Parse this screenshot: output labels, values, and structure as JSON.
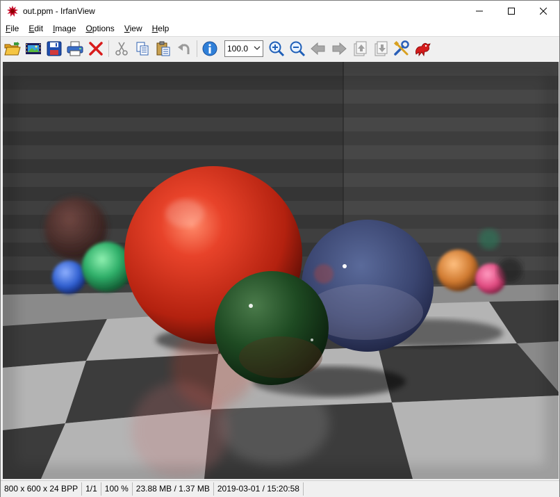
{
  "window": {
    "title": "out.ppm - IrfanView",
    "icon": "irfanview-red-splat-icon"
  },
  "menu": [
    {
      "label": "File",
      "accel": "F",
      "rest": "ile"
    },
    {
      "label": "Edit",
      "accel": "E",
      "rest": "dit"
    },
    {
      "label": "Image",
      "accel": "I",
      "rest": "mage"
    },
    {
      "label": "Options",
      "accel": "O",
      "rest": "ptions"
    },
    {
      "label": "View",
      "accel": "V",
      "rest": "iew"
    },
    {
      "label": "Help",
      "accel": "H",
      "rest": "elp"
    }
  ],
  "toolbar": {
    "zoom_value": "100.0",
    "icons": [
      "open-folder-icon",
      "slideshow-icon",
      "save-icon",
      "print-icon",
      "delete-icon",
      "cut-icon",
      "copy-icon",
      "paste-icon",
      "undo-icon",
      "info-icon",
      "zoom-in-icon",
      "zoom-out-icon",
      "previous-icon",
      "next-icon",
      "page-up-icon",
      "page-down-icon",
      "settings-icon",
      "irfanview-icon"
    ]
  },
  "status": {
    "dimensions": "800 x 600 x 24 BPP",
    "page": "1/1",
    "zoom": "100 %",
    "memory": "23.88 MB / 1.37 MB",
    "datetime": "2019-03-01 / 15:20:58"
  },
  "colors": {
    "accent_blue": "#2f7fd8",
    "delete_red": "#d81b1b",
    "checker_light": "#b4b4b4",
    "checker_dark": "#3c3c3c"
  }
}
